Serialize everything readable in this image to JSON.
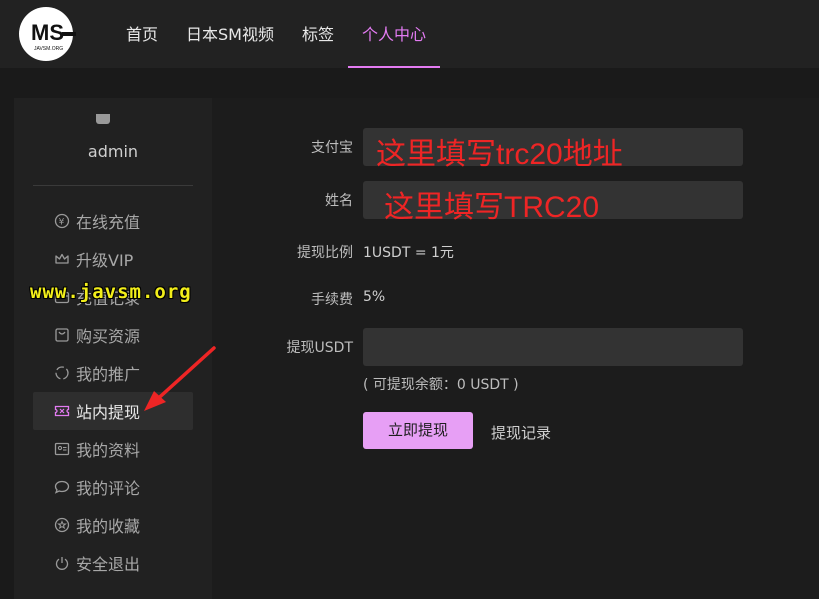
{
  "header": {
    "logo_text": "MS",
    "logo_small": "JAVSM.ORG",
    "nav": [
      {
        "label": "首页"
      },
      {
        "label": "日本SM视频"
      },
      {
        "label": "标签"
      },
      {
        "label": "个人中心"
      }
    ]
  },
  "sidebar": {
    "username": "admin",
    "items": [
      {
        "label": "在线充值",
        "icon": "yen-circle-icon"
      },
      {
        "label": "升级VIP",
        "icon": "crown-icon"
      },
      {
        "label": "充值记录",
        "icon": "wallet-icon"
      },
      {
        "label": "购买资源",
        "icon": "shopping-bag-icon"
      },
      {
        "label": "我的推广",
        "icon": "promote-icon"
      },
      {
        "label": "站内提现",
        "icon": "ticket-icon"
      },
      {
        "label": "我的资料",
        "icon": "profile-card-icon"
      },
      {
        "label": "我的评论",
        "icon": "comment-icon"
      },
      {
        "label": "我的收藏",
        "icon": "star-circle-icon"
      },
      {
        "label": "安全退出",
        "icon": "power-icon"
      }
    ]
  },
  "form": {
    "alipay_label": "支付宝",
    "alipay_value": "这里填写trc20地址",
    "name_label": "姓名",
    "name_value": "这里填写TRC20",
    "ratio_label": "提现比例",
    "ratio_value": "1USDT = 1元",
    "fee_label": "手续费",
    "fee_value": "5%",
    "amount_label": "提现USDT",
    "amount_value": "",
    "balance_note": "( 可提现余额：0 USDT )",
    "submit_label": "立即提现",
    "record_label": "提现记录"
  },
  "watermark": "www.javsm.org",
  "colors": {
    "accent": "#e37bf2",
    "button": "#e79ff5",
    "overlay_red": "#ee2525",
    "watermark_yellow": "#f2ee1a"
  }
}
